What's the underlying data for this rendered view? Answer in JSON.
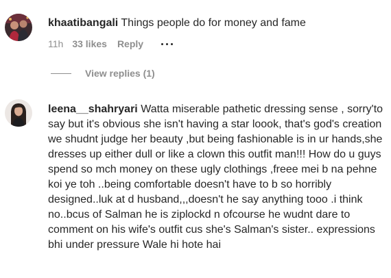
{
  "comments": [
    {
      "username": "khaatibangali",
      "text": "Things people do for money and fame",
      "time": "11h",
      "likes": "33 likes",
      "reply_label": "Reply",
      "more_icon": "more-horizontal-icon",
      "view_replies": "View replies (1)"
    },
    {
      "username": "leena__shahryari",
      "text": "Watta miserable pathetic dressing sense , sorry'to say but it's obvious she isn't having a star loook, that's god's creation we shudnt judge her beauty ,but being fashionable is in ur hands,she dresses up either dull or like a clown this outfit man!!! How do u guys spend so mch money on these ugly clothings ,freee mei b na pehne koi ye toh ..being comfortable doesn't have to b so horribly designed..luk at d husband,,,doesn't he say anything tooo .i think no..bcus of Salman he is ziplockd n ofcourse he wudnt dare to comment on his wife's outfit cus she's Salman's sister.. expressions bhi under pressure Wale hi hote hai"
    }
  ],
  "colors": {
    "text_primary": "#262626",
    "text_secondary": "#8e8e8e"
  }
}
